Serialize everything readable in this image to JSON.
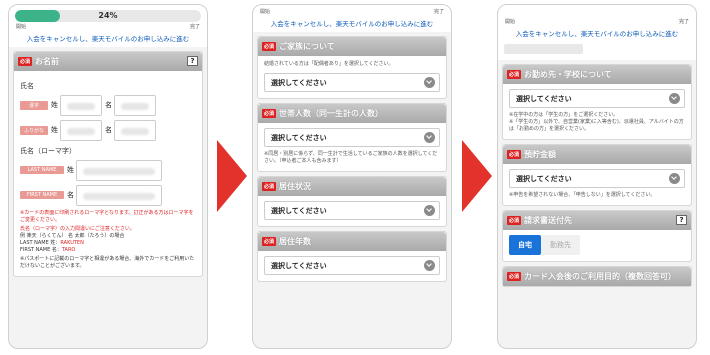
{
  "progress": {
    "percent_text": "24%",
    "fraction": 0.24,
    "start_label": "開始",
    "end_label": "完了"
  },
  "cancel_link": "入会をキャンセルし、楽天モバイルのお申し込みに進む",
  "required_badge": "必須",
  "select_placeholder": "選択してください",
  "screen1": {
    "section_title": "お名前",
    "name_label": "氏名",
    "kanji_tag": "漢字",
    "furigana_tag": "ふりがな",
    "sei": "姓",
    "mei": "名",
    "romaji_label": "氏名（ローマ字）",
    "last_name_tag": "LAST NAME",
    "first_name_tag": "FIRST NAME",
    "note_red": "※カードの表面に印刷されるローマ字となります。訂正がある方はローマ字をご変更ください。",
    "note_red2": "氏名（ローマ字）の入力間違いにご注意ください。",
    "example_line": "例 楽天（らくてん） 名 太郎（たろう）の場合",
    "example_last_label": "LAST NAME 姓：",
    "example_last": "RAKUTEN",
    "example_first_label": "FIRST NAME 名：",
    "example_first": "TARO",
    "passport_note": "※パスポートに記載のローマ字と相違がある場合、海外でカードをご利用いただけないことがございます。"
  },
  "screen2": {
    "family_title": "ご家族について",
    "family_note": "結婚されている方は「配偶者あり」を選択してください。",
    "household_title": "世帯人数（同一生計の人数）",
    "household_note": "※同居・別居に係らず、同一生計で生活しているご家族の人数を選択してください。（申込者ご本人も含みます）",
    "residence_title": "居住状況",
    "years_title": "居住年数"
  },
  "screen3": {
    "employment_title": "お勤め先・学校について",
    "employment_note1": "※在学中の方は「学生の方」をご選択ください。",
    "employment_note2": "※「学生の方」以外で、自営業(家業)に入等含む)、派遣社員、アルバイトの方は「お勤めの方」を選択ください。",
    "savings_title": "預貯金額",
    "savings_note": "※申告を希望されない場合、「申告しない」を選択してください。",
    "mail_title": "請求書送付先",
    "mail_options": [
      "自宅",
      "勤務先"
    ],
    "usage_title": "カード入会後のご利用目的（複数回答可）"
  }
}
